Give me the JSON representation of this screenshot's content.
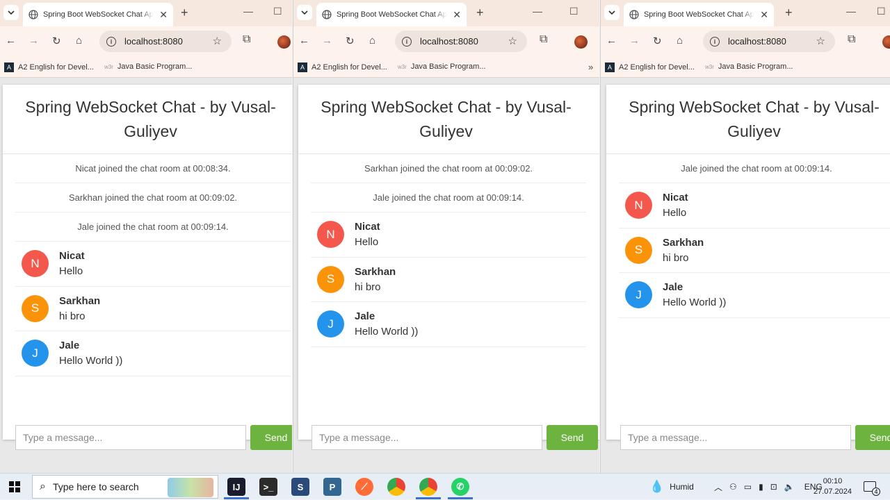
{
  "browser": {
    "tab_title": "Spring Boot WebSocket Chat Ap",
    "url": "localhost:8080",
    "bookmarks": [
      "A2 English for Devel...",
      "Java Basic Program..."
    ],
    "new_tab_symbol": "+",
    "minimize_symbol": "—",
    "maximize_symbol": "☐"
  },
  "chat": {
    "title": "Spring WebSocket Chat - by Vusal-Guliyev",
    "input_placeholder": "Type a message...",
    "send_label": "Send"
  },
  "colors": {
    "nicat": "#f4584d",
    "sarkhan": "#fb9309",
    "jale": "#2493ec",
    "send": "#6db33f"
  },
  "windows": [
    {
      "events": [
        "Nicat joined the chat room at 00:08:34.",
        "Sarkhan joined the chat room at 00:09:02.",
        "Jale joined the chat room at 00:09:14."
      ],
      "messages": [
        {
          "initial": "N",
          "name": "Nicat",
          "text": "Hello"
        },
        {
          "initial": "S",
          "name": "Sarkhan",
          "text": "hi bro"
        },
        {
          "initial": "J",
          "name": "Jale",
          "text": "Hello World ))"
        }
      ]
    },
    {
      "events": [
        "Sarkhan joined the chat room at 00:09:02.",
        "Jale joined the chat room at 00:09:14."
      ],
      "messages": [
        {
          "initial": "N",
          "name": "Nicat",
          "text": "Hello"
        },
        {
          "initial": "S",
          "name": "Sarkhan",
          "text": "hi bro"
        },
        {
          "initial": "J",
          "name": "Jale",
          "text": "Hello World ))"
        }
      ]
    },
    {
      "events": [
        "Jale joined the chat room at 00:09:14."
      ],
      "messages": [
        {
          "initial": "N",
          "name": "Nicat",
          "text": "Hello"
        },
        {
          "initial": "S",
          "name": "Sarkhan",
          "text": "hi bro"
        },
        {
          "initial": "J",
          "name": "Jale",
          "text": "Hello World ))"
        }
      ]
    }
  ],
  "taskbar": {
    "search_placeholder": "Type here to search",
    "weather": "Humid",
    "language": "ENG",
    "time": "00:10",
    "date": "27.07.2024",
    "notifications_count": "4",
    "apps": [
      "intellij-icon",
      "terminal-icon",
      "vscode-icon",
      "postgres-icon",
      "postman-icon",
      "chrome-icon",
      "chrome-profile-icon",
      "whatsapp-icon"
    ]
  }
}
